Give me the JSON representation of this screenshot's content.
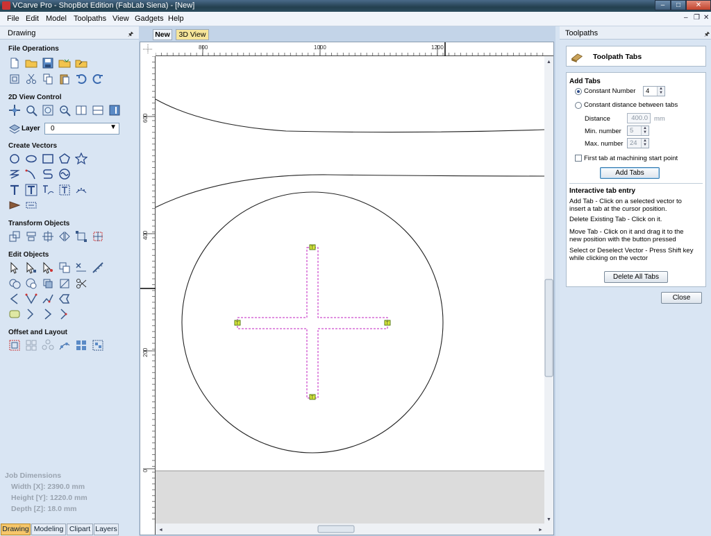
{
  "window": {
    "title": "VCarve Pro - ShopBot Edition (FabLab Siena) - [New]",
    "minimize": "–",
    "maximize": "□",
    "close": "✕"
  },
  "menu": {
    "items": [
      "File",
      "Edit",
      "Model",
      "Toolpaths",
      "View",
      "Gadgets",
      "Help"
    ],
    "mdi_controls": [
      "–",
      "❐",
      "✕"
    ]
  },
  "left_panel": {
    "title": "Drawing",
    "pin": "🖈",
    "sections": {
      "file_operations": "File Operations",
      "view_2d": "2D View Control",
      "create_vectors": "Create Vectors",
      "transform_objects": "Transform Objects",
      "edit_objects": "Edit Objects",
      "offset_layout": "Offset and Layout"
    },
    "layer": {
      "label": "Layer",
      "value": "0",
      "arrow": "▼"
    },
    "job_dimensions": {
      "title": "Job Dimensions",
      "width": "Width  [X]: 2390.0 mm",
      "height": "Height [Y]: 1220.0 mm",
      "depth": "Depth  [Z]: 18.0 mm"
    },
    "tabs": [
      "Drawing",
      "Modeling",
      "Clipart",
      "Layers"
    ]
  },
  "view": {
    "tabs": [
      "New",
      "3D View"
    ],
    "ruler_top": [
      "800",
      "1000",
      "1200"
    ],
    "ruler_left": [
      "600",
      "400",
      "200",
      "0"
    ],
    "scroll_up": "▲",
    "scroll_down": "▼",
    "scroll_left": "◄",
    "scroll_right": "►",
    "tab_marker": "T"
  },
  "right_panel": {
    "title": "Toolpaths",
    "pin": "🖈",
    "header": "Toolpath Tabs",
    "add_tabs": {
      "title": "Add Tabs",
      "constant_number_label": "Constant Number",
      "constant_number_value": "4",
      "constant_distance_label": "Constant distance between tabs",
      "distance_label": "Distance",
      "distance_value": "400.0",
      "distance_unit": "mm",
      "min_label": "Min. number",
      "min_value": "5",
      "max_label": "Max. number",
      "max_value": "24",
      "first_tab_label": "First tab at machining start point",
      "add_button": "Add Tabs",
      "spin_up": "▲",
      "spin_down": "▼"
    },
    "interactive": {
      "title": "Interactive tab entry",
      "add_tab": "Add Tab - Click on a selected vector to insert a tab at the cursor position.",
      "delete_tab": "Delete Existing Tab - Click on it.",
      "move_tab": "Move Tab - Click on it and drag it to the new position with the button pressed",
      "select": "Select or Deselect Vector - Press Shift key while clicking on the vector",
      "delete_all_button": "Delete All Tabs"
    },
    "close_button": "Close"
  }
}
